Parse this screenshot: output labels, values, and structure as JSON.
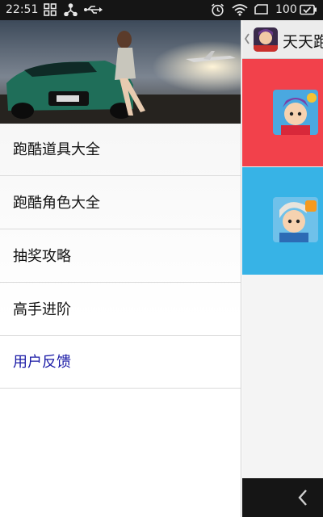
{
  "status_bar": {
    "time": "22:51",
    "battery_level": "100",
    "icons": [
      "grid-icon",
      "share-icon",
      "usb-icon",
      "alarm-icon",
      "wifi-icon",
      "cast-icon",
      "battery-icon"
    ]
  },
  "drawer": {
    "hero_image": "car-and-model-banner",
    "items": [
      {
        "label": "跑酷道具大全"
      },
      {
        "label": "跑酷角色大全"
      },
      {
        "label": "抽奖攻略"
      },
      {
        "label": "高手进阶"
      },
      {
        "label": "用户反馈"
      }
    ]
  },
  "main": {
    "title": "天天跑",
    "back_icon": "chevron-left-icon",
    "cards": [
      {
        "color": "#f2414b",
        "icon": "character-avatar"
      },
      {
        "color": "#37b3e6",
        "icon": "character-avatar"
      }
    ]
  },
  "nav_bar": {
    "back_icon": "back-chevron-icon"
  }
}
